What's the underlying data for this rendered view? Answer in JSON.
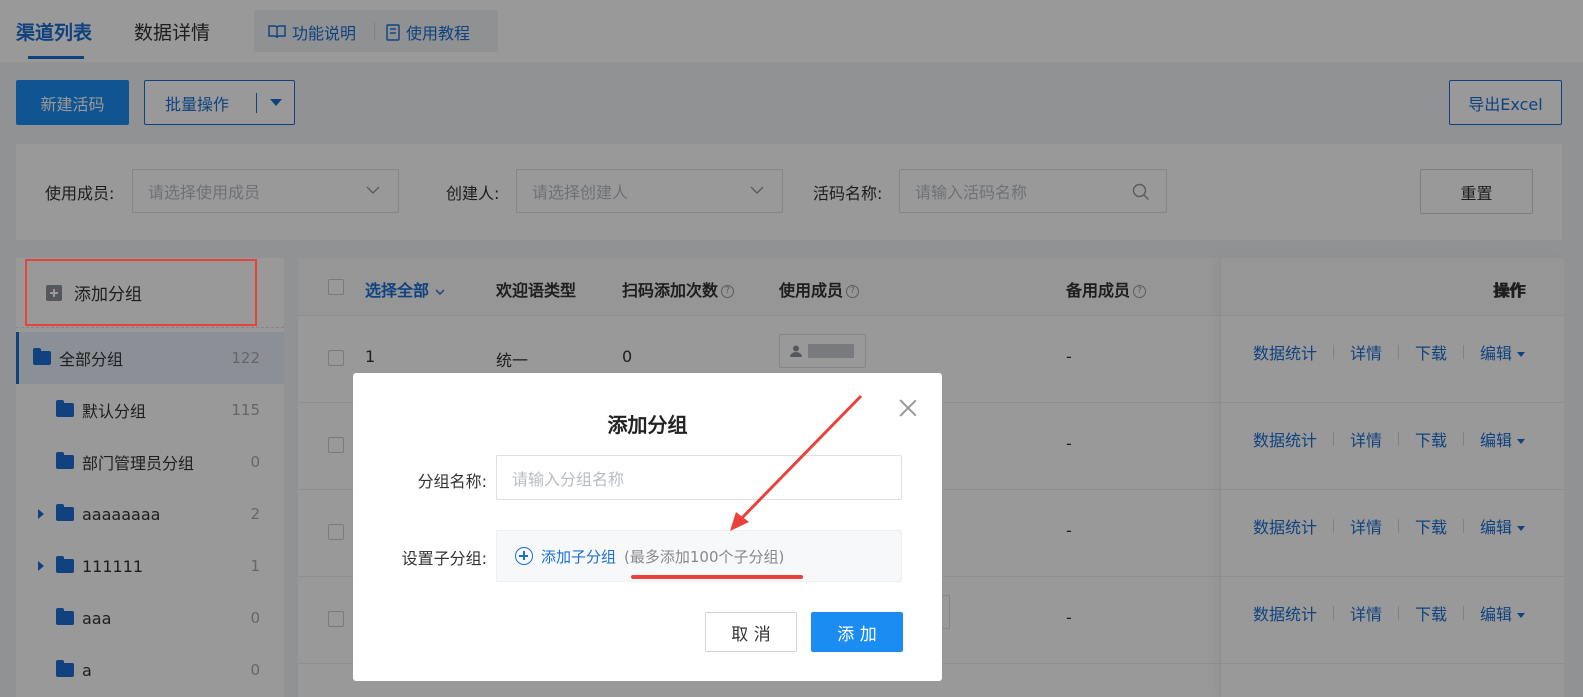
{
  "tabs": {
    "active": "渠道列表",
    "second": "数据详情"
  },
  "help_links": {
    "feature_desc": "功能说明",
    "tutorial": "使用教程"
  },
  "toolbar": {
    "new_code": "新建活码",
    "batch_ops": "批量操作",
    "export": "导出Excel"
  },
  "filters": {
    "member_label": "使用成员:",
    "member_placeholder": "请选择使用成员",
    "creator_label": "创建人:",
    "creator_placeholder": "请选择创建人",
    "name_label": "活码名称:",
    "name_placeholder": "请输入活码名称",
    "reset": "重置"
  },
  "sidebar": {
    "add_group": "添加分组",
    "items": [
      {
        "label": "全部分组",
        "count": "122",
        "expandable": false
      },
      {
        "label": "默认分组",
        "count": "115",
        "expandable": false
      },
      {
        "label": "部门管理员分组",
        "count": "0",
        "expandable": false
      },
      {
        "label": "aaaaaaaa",
        "count": "2",
        "expandable": true
      },
      {
        "label": "111111",
        "count": "1",
        "expandable": true
      },
      {
        "label": "aaa",
        "count": "0",
        "expandable": false
      },
      {
        "label": "a",
        "count": "0",
        "expandable": false
      }
    ]
  },
  "table": {
    "headers": {
      "select_all": "选择全部",
      "welcome_type": "欢迎语类型",
      "scan_count": "扫码添加次数",
      "members": "使用成员",
      "backup": "备用成员",
      "actions": "操作"
    },
    "rows": [
      {
        "index": "1",
        "welcome_type": "统一",
        "scan_count": "0",
        "backup": "-"
      },
      {
        "index": "",
        "welcome_type": "",
        "scan_count": "",
        "backup": "-"
      },
      {
        "index": "",
        "welcome_type": "",
        "scan_count": "",
        "backup": "-"
      },
      {
        "index": "",
        "welcome_type": "",
        "scan_count": "",
        "backup": "-"
      }
    ],
    "row_actions": {
      "stats": "数据统计",
      "detail": "详情",
      "download": "下载",
      "edit": "编辑"
    }
  },
  "modal": {
    "title": "添加分组",
    "name_label": "分组名称:",
    "name_placeholder": "请输入分组名称",
    "sub_label": "设置子分组:",
    "add_sub": "添加子分组",
    "sub_hint": "(最多添加100个子分组)",
    "cancel": "取 消",
    "confirm": "添 加"
  },
  "colors": {
    "primary": "#1b8cf2",
    "link": "#1a6fd4",
    "annotation": "#e8423a"
  }
}
